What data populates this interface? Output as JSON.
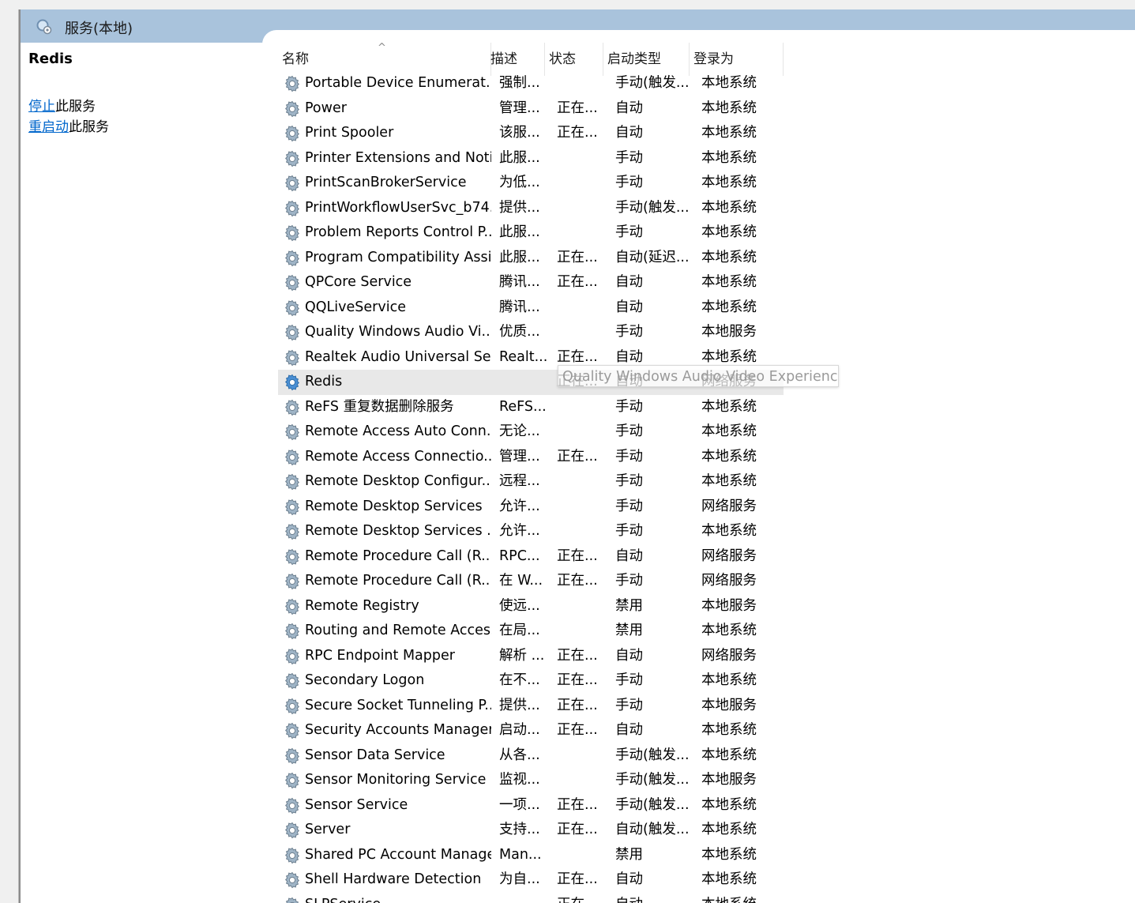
{
  "window": {
    "title": "服务(本地)"
  },
  "left_pane": {
    "service_name": "Redis",
    "actions": [
      {
        "link": "停止",
        "suffix": "此服务"
      },
      {
        "link": "重启动",
        "suffix": "此服务"
      }
    ]
  },
  "columns": {
    "name": "名称",
    "sort_indicator": "^",
    "desc": "描述",
    "status": "状态",
    "startup": "启动类型",
    "logon": "登录为"
  },
  "tooltip": "Quality Windows Audio Video Experience",
  "selected_index": 12,
  "services": [
    {
      "name": "Portable Device Enumerat...",
      "desc": "强制...",
      "status": "",
      "startup": "手动(触发...",
      "logon": "本地系统"
    },
    {
      "name": "Power",
      "desc": "管理...",
      "status": "正在...",
      "startup": "自动",
      "logon": "本地系统"
    },
    {
      "name": "Print Spooler",
      "desc": "该服...",
      "status": "正在...",
      "startup": "自动",
      "logon": "本地系统"
    },
    {
      "name": "Printer Extensions and Noti...",
      "desc": "此服...",
      "status": "",
      "startup": "手动",
      "logon": "本地系统"
    },
    {
      "name": "PrintScanBrokerService",
      "desc": "为低...",
      "status": "",
      "startup": "手动",
      "logon": "本地系统"
    },
    {
      "name": "PrintWorkflowUserSvc_b74...",
      "desc": "提供...",
      "status": "",
      "startup": "手动(触发...",
      "logon": "本地系统"
    },
    {
      "name": "Problem Reports Control P...",
      "desc": "此服...",
      "status": "",
      "startup": "手动",
      "logon": "本地系统"
    },
    {
      "name": "Program Compatibility Assi...",
      "desc": "此服...",
      "status": "正在...",
      "startup": "自动(延迟...",
      "logon": "本地系统"
    },
    {
      "name": "QPCore Service",
      "desc": "腾讯...",
      "status": "正在...",
      "startup": "自动",
      "logon": "本地系统"
    },
    {
      "name": "QQLiveService",
      "desc": "腾讯...",
      "status": "",
      "startup": "自动",
      "logon": "本地系统"
    },
    {
      "name": "Quality Windows Audio Vi...",
      "desc": "优质...",
      "status": "",
      "startup": "手动",
      "logon": "本地服务"
    },
    {
      "name": "Realtek Audio Universal Se...",
      "desc": "Realt...",
      "status": "正在...",
      "startup": "自动",
      "logon": "本地系统"
    },
    {
      "name": "Redis",
      "desc": "",
      "status": "正在...",
      "startup": "自动",
      "logon": "网络服务"
    },
    {
      "name": "ReFS 重复数据删除服务",
      "desc": "ReFS...",
      "status": "",
      "startup": "手动",
      "logon": "本地系统"
    },
    {
      "name": "Remote Access Auto Conn...",
      "desc": "无论...",
      "status": "",
      "startup": "手动",
      "logon": "本地系统"
    },
    {
      "name": "Remote Access Connectio...",
      "desc": "管理...",
      "status": "正在...",
      "startup": "手动",
      "logon": "本地系统"
    },
    {
      "name": "Remote Desktop Configur...",
      "desc": "远程...",
      "status": "",
      "startup": "手动",
      "logon": "本地系统"
    },
    {
      "name": "Remote Desktop Services",
      "desc": "允许...",
      "status": "",
      "startup": "手动",
      "logon": "网络服务"
    },
    {
      "name": "Remote Desktop Services ...",
      "desc": "允许...",
      "status": "",
      "startup": "手动",
      "logon": "本地系统"
    },
    {
      "name": "Remote Procedure Call (R...",
      "desc": "RPC...",
      "status": "正在...",
      "startup": "自动",
      "logon": "网络服务"
    },
    {
      "name": "Remote Procedure Call (R...",
      "desc": "在 W...",
      "status": "正在...",
      "startup": "手动",
      "logon": "网络服务"
    },
    {
      "name": "Remote Registry",
      "desc": "使远...",
      "status": "",
      "startup": "禁用",
      "logon": "本地服务"
    },
    {
      "name": "Routing and Remote Access",
      "desc": "在局...",
      "status": "",
      "startup": "禁用",
      "logon": "本地系统"
    },
    {
      "name": "RPC Endpoint Mapper",
      "desc": "解析 ...",
      "status": "正在...",
      "startup": "自动",
      "logon": "网络服务"
    },
    {
      "name": "Secondary Logon",
      "desc": "在不...",
      "status": "正在...",
      "startup": "手动",
      "logon": "本地系统"
    },
    {
      "name": "Secure Socket Tunneling P...",
      "desc": "提供...",
      "status": "正在...",
      "startup": "手动",
      "logon": "本地服务"
    },
    {
      "name": "Security Accounts Manager",
      "desc": "启动...",
      "status": "正在...",
      "startup": "自动",
      "logon": "本地系统"
    },
    {
      "name": "Sensor Data Service",
      "desc": "从各...",
      "status": "",
      "startup": "手动(触发...",
      "logon": "本地系统"
    },
    {
      "name": "Sensor Monitoring Service",
      "desc": "监视...",
      "status": "",
      "startup": "手动(触发...",
      "logon": "本地服务"
    },
    {
      "name": "Sensor Service",
      "desc": "一项...",
      "status": "正在...",
      "startup": "手动(触发...",
      "logon": "本地系统"
    },
    {
      "name": "Server",
      "desc": "支持...",
      "status": "正在...",
      "startup": "自动(触发...",
      "logon": "本地系统"
    },
    {
      "name": "Shared PC Account Manager",
      "desc": "Man...",
      "status": "",
      "startup": "禁用",
      "logon": "本地系统"
    },
    {
      "name": "Shell Hardware Detection",
      "desc": "为自...",
      "status": "正在...",
      "startup": "自动",
      "logon": "本地系统"
    },
    {
      "name": "SLPService",
      "desc": "",
      "status": "正在...",
      "startup": "自动",
      "logon": "本地系统"
    }
  ]
}
